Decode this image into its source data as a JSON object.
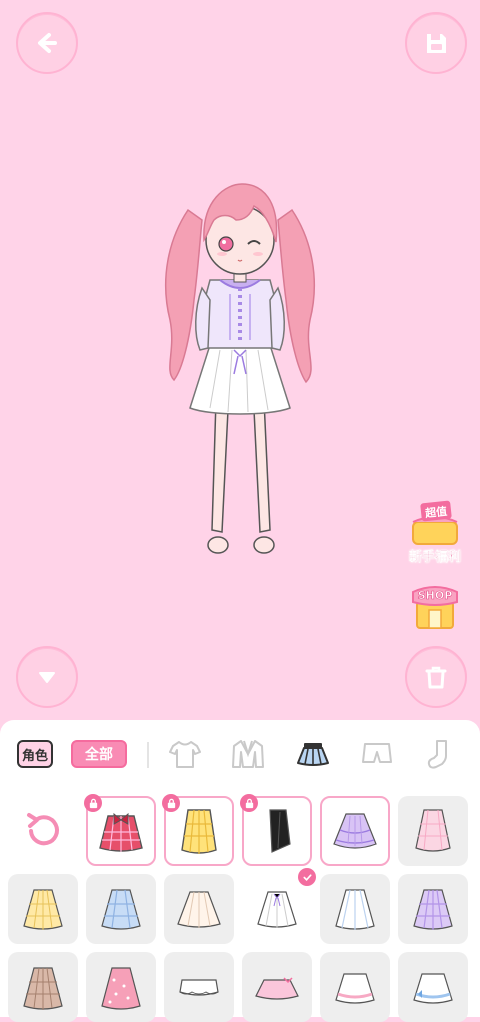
{
  "colors": {
    "background": "#ffd3e8",
    "accent": "#f36d9f",
    "panel": "#ffffff"
  },
  "top_bar": {
    "back_icon": "back-arrow-icon",
    "save_icon": "save-icon"
  },
  "promo": {
    "welfare_badge": "超值",
    "welfare_label": "新手福利",
    "shop_label": "SHOP"
  },
  "bottom_controls": {
    "collapse_icon": "chevron-down-icon",
    "delete_icon": "trash-icon"
  },
  "tabs": {
    "role_label": "角色",
    "all_label": "全部",
    "categories": [
      "top-icon",
      "jacket-icon",
      "skirt-icon",
      "pants-icon",
      "sock-icon"
    ]
  },
  "items": {
    "reset_icon": "refresh-icon",
    "row1": [
      "locked",
      "locked",
      "locked",
      "shop",
      "normal"
    ],
    "row2": [
      "normal",
      "normal",
      "normal",
      "selected",
      "normal",
      "normal"
    ],
    "row3": [
      "normal",
      "normal",
      "normal",
      "normal",
      "normal",
      "normal"
    ]
  }
}
